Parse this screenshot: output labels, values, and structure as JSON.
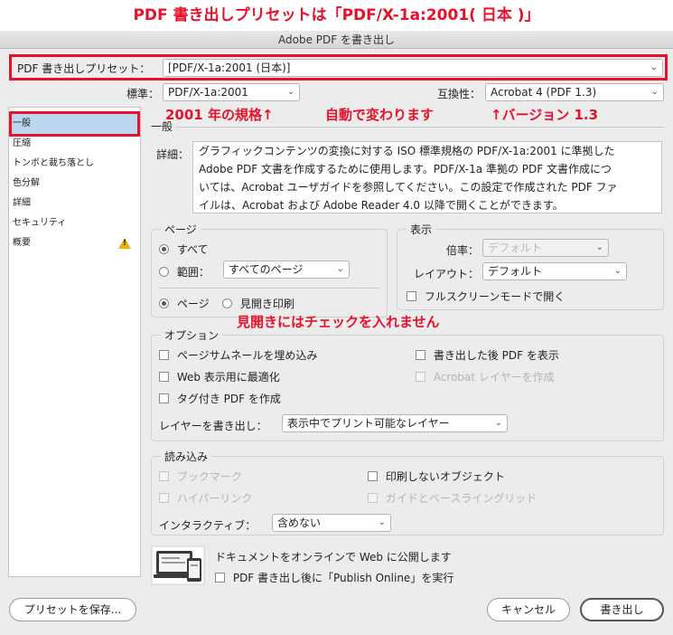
{
  "banner": {
    "title": "PDF 書き出しプリセットは「PDF/X-1a:2001( 日本 )」"
  },
  "window": {
    "title": "Adobe PDF を書き出し"
  },
  "preset": {
    "label": "PDF 書き出しプリセット：",
    "value": "[PDF/X-1a:2001 (日本)]"
  },
  "standard": {
    "label": "標準：",
    "value": "PDF/X-1a:2001"
  },
  "compat": {
    "label": "互換性：",
    "value": "Acrobat 4 (PDF 1.3)"
  },
  "annotations": {
    "standard_note": "2001 年の規格↑",
    "auto_note": "自動で変わります",
    "version_note": "↑バージョン 1.3",
    "spreads_note": "見開きにはチェックを入れません"
  },
  "sidebar": {
    "items": [
      {
        "label": "一般"
      },
      {
        "label": "圧縮"
      },
      {
        "label": "トンボと裁ち落とし"
      },
      {
        "label": "色分解"
      },
      {
        "label": "詳細"
      },
      {
        "label": "セキュリティ"
      },
      {
        "label": "概要"
      }
    ]
  },
  "general": {
    "section_title": "一般",
    "desc_label": "詳細：",
    "description_lines": [
      "グラフィックコンテンツの変換に対する ISO 標準規格の PDF/X-1a:2001 に準拠した",
      "Adobe PDF 文書を作成するために使用します。PDF/X-1a 準拠の PDF 文書作成につ",
      "いては、Acrobat ユーザガイドを参照してください。この設定で作成された PDF ファ",
      "イルは、Acrobat および Adobe Reader 4.0 以降で開くことができます。"
    ]
  },
  "pages": {
    "title": "ページ",
    "all_label": "すべて",
    "range_label": "範囲：",
    "range_value": "すべてのページ",
    "pages_label": "ページ",
    "spreads_label": "見開き印刷"
  },
  "view": {
    "title": "表示",
    "zoom_label": "倍率：",
    "zoom_value": "デフォルト",
    "layout_label": "レイアウト：",
    "layout_value": "デフォルト",
    "fullscreen_label": "フルスクリーンモードで開く"
  },
  "options": {
    "title": "オプション",
    "thumbnails": "ページサムネールを埋め込み",
    "optimize_web": "Web 表示用に最適化",
    "tagged_pdf": "タグ付き PDF を作成",
    "view_after": "書き出した後 PDF を表示",
    "acrobat_layers": "Acrobat レイヤーを作成",
    "layers_label": "レイヤーを書き出し：",
    "layers_value": "表示中でプリント可能なレイヤー"
  },
  "include": {
    "title": "読み込み",
    "bookmarks": "ブックマーク",
    "hyperlinks": "ハイパーリンク",
    "nonprinting": "印刷しないオブジェクト",
    "guides": "ガイドとベースライングリッド",
    "interactive_label": "インタラクティブ：",
    "interactive_value": "含めない"
  },
  "publish": {
    "headline": "ドキュメントをオンラインで Web に公開します",
    "checkbox_label": "PDF 書き出し後に「Publish Online」を実行"
  },
  "footer": {
    "save_preset": "プリセットを保存...",
    "cancel": "キャンセル",
    "export": "書き出し"
  },
  "colors": {
    "accent_red": "#e8102a",
    "selection_blue": "#bcd6ef",
    "warning_yellow": "#e8b400"
  }
}
